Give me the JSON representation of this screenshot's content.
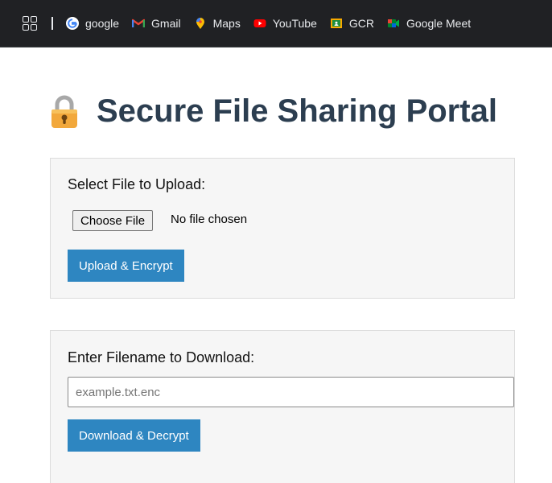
{
  "bookmarks": {
    "items": [
      {
        "label": "google",
        "icon": "google-icon"
      },
      {
        "label": "Gmail",
        "icon": "gmail-icon"
      },
      {
        "label": "Maps",
        "icon": "maps-icon"
      },
      {
        "label": "YouTube",
        "icon": "youtube-icon"
      },
      {
        "label": "GCR",
        "icon": "classroom-icon"
      },
      {
        "label": "Google Meet",
        "icon": "meet-icon"
      }
    ]
  },
  "page": {
    "title": "Secure File Sharing Portal",
    "title_icon": "lock-icon"
  },
  "upload": {
    "label": "Select File to Upload:",
    "choose_button": "Choose File",
    "file_status": "No file chosen",
    "submit_label": "Upload & Encrypt"
  },
  "download": {
    "label": "Enter Filename to Download:",
    "placeholder": "example.txt.enc",
    "value": "",
    "submit_label": "Download & Decrypt"
  },
  "colors": {
    "bookmark_bar_bg": "#202124",
    "title": "#2c3e50",
    "button_accent": "#2e86c1",
    "panel_bg": "#f6f6f6"
  }
}
